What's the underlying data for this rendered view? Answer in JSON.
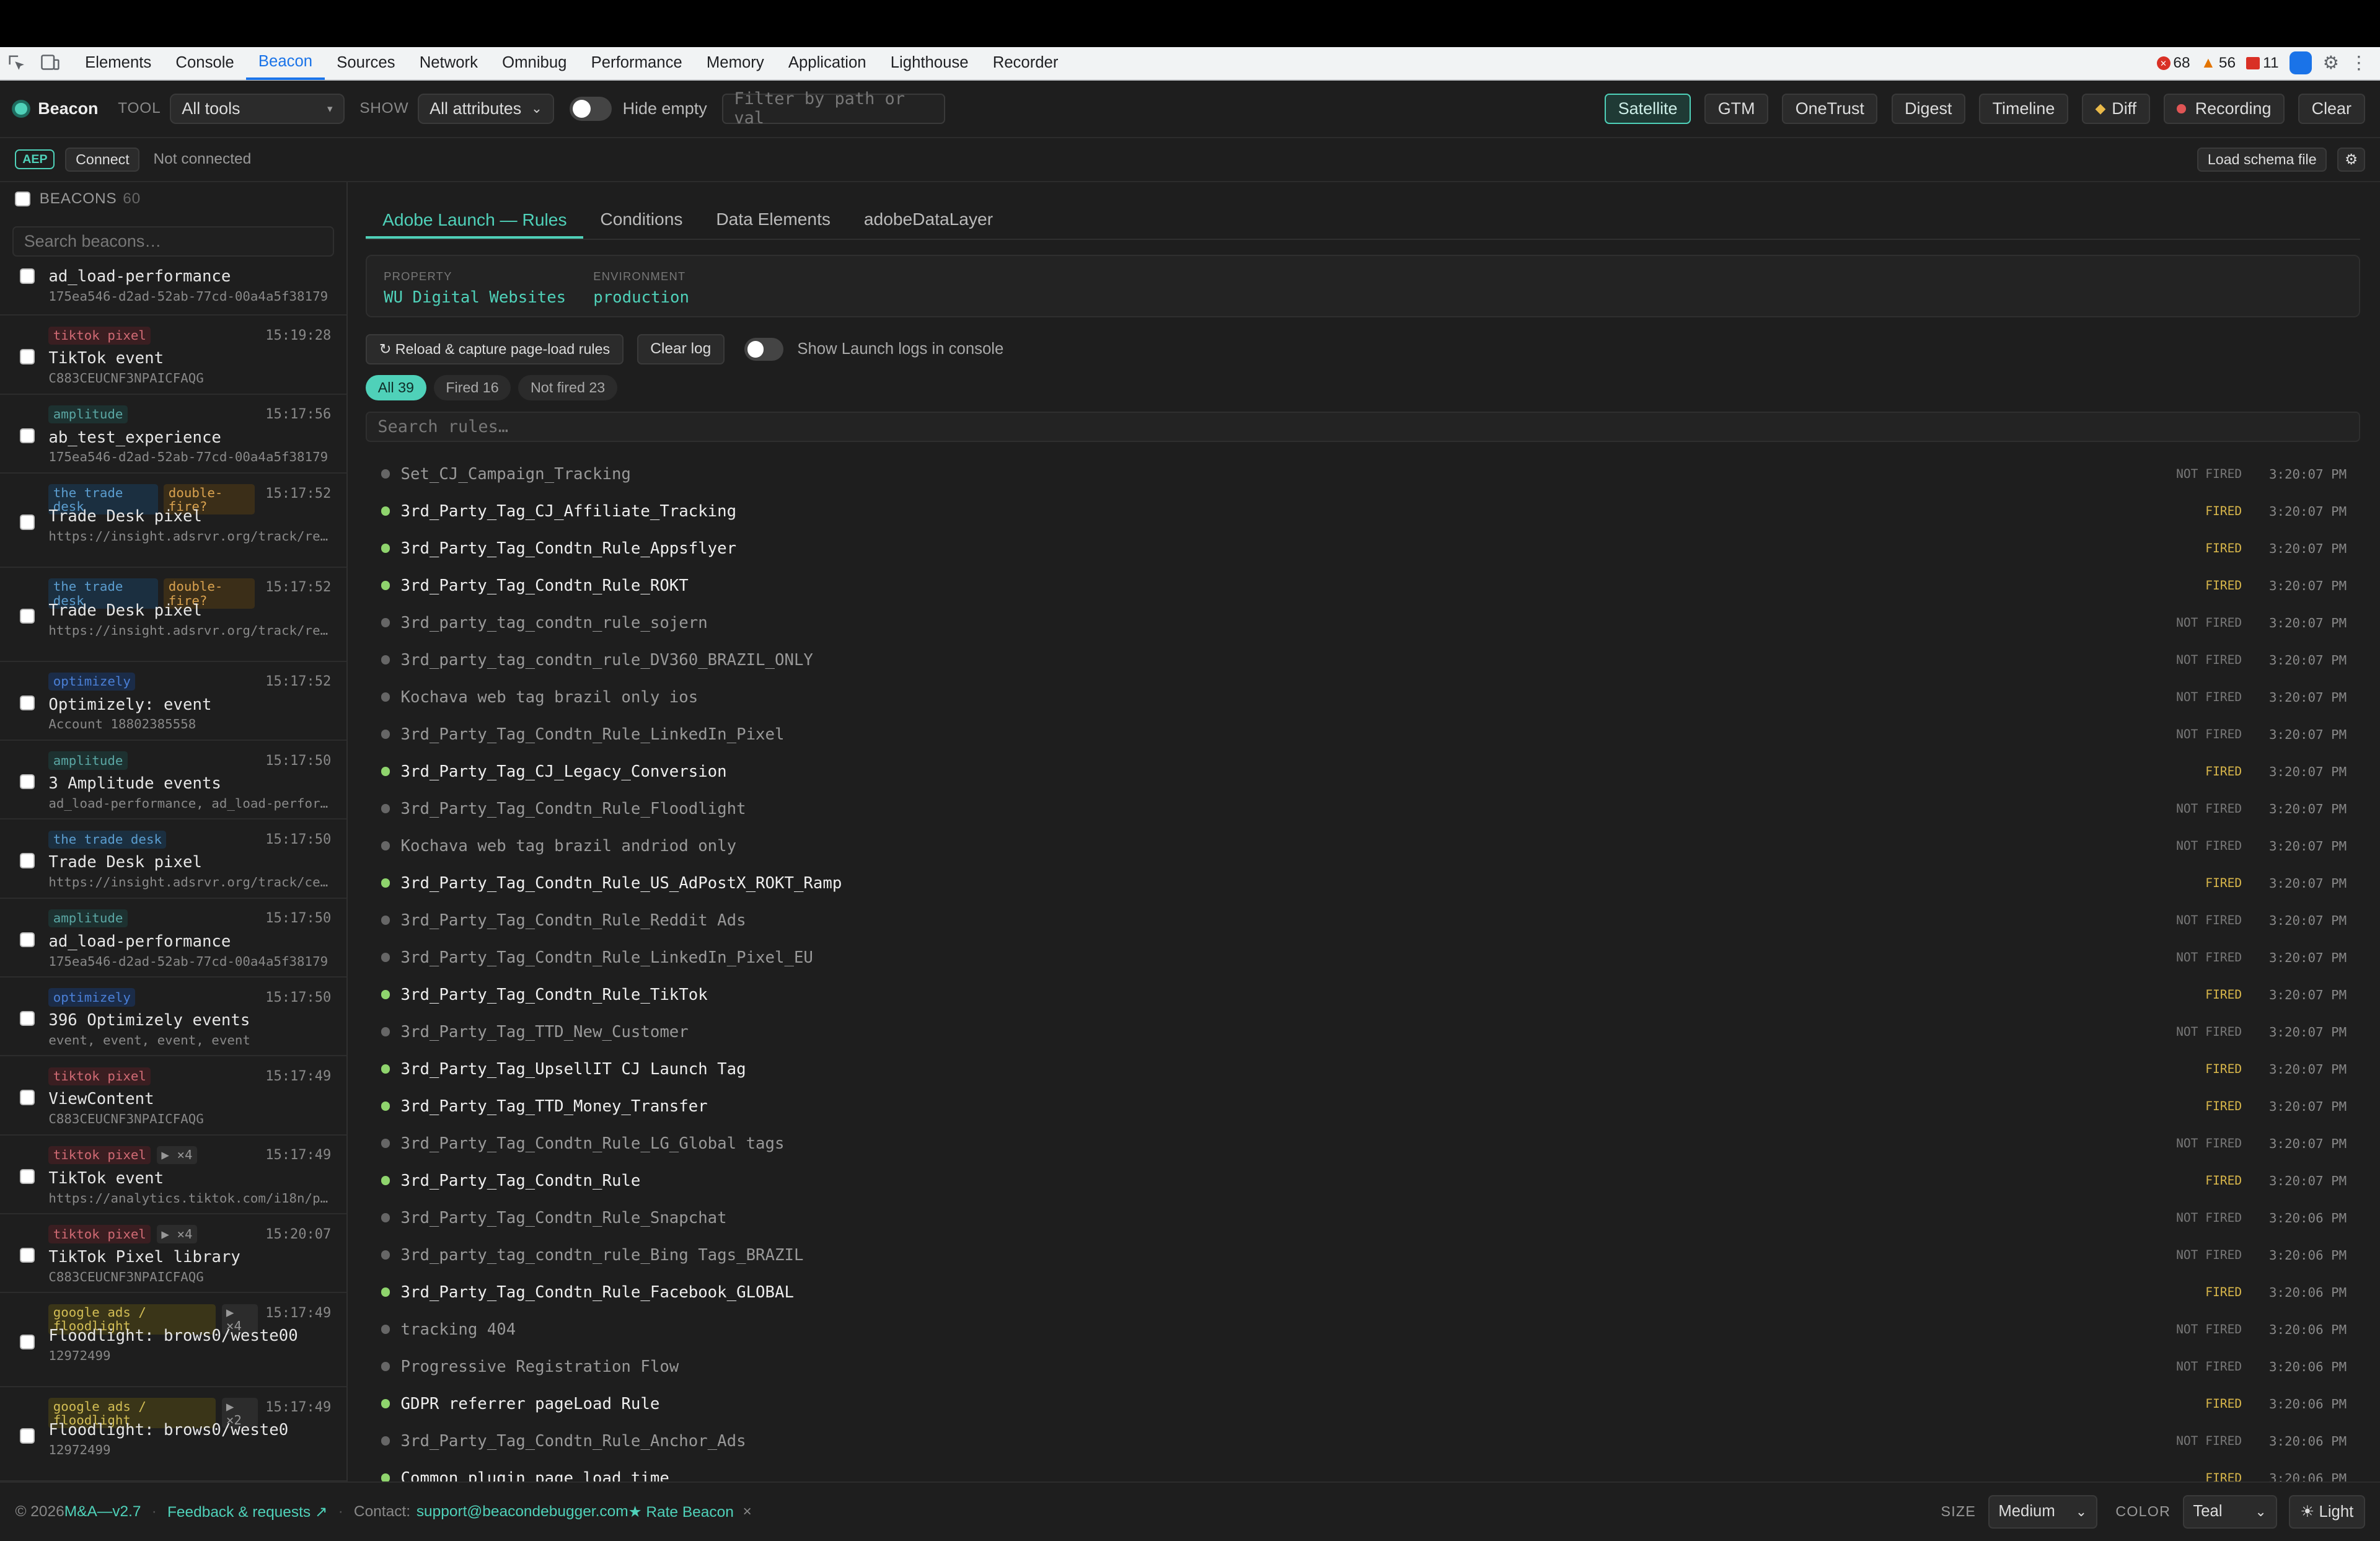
{
  "devtools": {
    "tabs": [
      "Elements",
      "Console",
      "Beacon",
      "Sources",
      "Network",
      "Omnibug",
      "Performance",
      "Memory",
      "Application",
      "Lighthouse",
      "Recorder"
    ],
    "active_tab": "Beacon",
    "errors": "68",
    "warnings": "56",
    "issues": "11"
  },
  "toolbar": {
    "brand": "Beacon",
    "tool_label": "TOOL",
    "tool_value": "All tools",
    "show_label": "SHOW",
    "show_value": "All attributes",
    "hide_empty": "Hide empty",
    "filter_placeholder": "Filter by path or val",
    "buttons": [
      "Satellite",
      "GTM",
      "OneTrust",
      "Digest",
      "Timeline",
      "Diff",
      "Recording",
      "Clear"
    ],
    "active_button": "Satellite"
  },
  "conn": {
    "badge": "AEP",
    "connect": "Connect",
    "status": "Not connected",
    "load_schema": "Load schema file",
    "settings_glyph": "⚙"
  },
  "sidebar": {
    "title": "BEACONS",
    "count": "60",
    "search_placeholder": "Search beacons…",
    "items": [
      {
        "tags": [],
        "time": "",
        "name": "ad_load-performance",
        "sub": "175ea546-d2ad-52ab-77cd-00a4a5f38179"
      },
      {
        "tags": [
          {
            "text": "tiktok pixel",
            "kind": "tiktok"
          }
        ],
        "time": "15:19:28",
        "name": "TikTok event",
        "sub": "C883CEUCNF3NPAICFAQG"
      },
      {
        "tags": [
          {
            "text": "amplitude",
            "kind": "amplitude"
          }
        ],
        "time": "15:17:56",
        "name": "ab_test_experience",
        "sub": "175ea546-d2ad-52ab-77cd-00a4a5f38179"
      },
      {
        "tags": [
          {
            "text": "the trade desk",
            "kind": "trade tall"
          },
          {
            "text": "double-fire?",
            "kind": "dbl tall2"
          }
        ],
        "time": "15:17:52",
        "name": "Trade Desk pixel",
        "sub": "https://insight.adsrvr.org/track/realtimeconversion"
      },
      {
        "tags": [
          {
            "text": "the trade desk",
            "kind": "trade tall"
          },
          {
            "text": "double-fire?",
            "kind": "dbl tall2"
          }
        ],
        "time": "15:17:52",
        "name": "Trade Desk pixel",
        "sub": "https://insight.adsrvr.org/track/realtimeconversion"
      },
      {
        "tags": [
          {
            "text": "optimizely",
            "kind": "opt"
          }
        ],
        "time": "15:17:52",
        "name": "Optimizely: event",
        "sub": "Account 18802385558"
      },
      {
        "tags": [
          {
            "text": "amplitude",
            "kind": "amplitude"
          }
        ],
        "time": "15:17:50",
        "name": "3 Amplitude events",
        "sub": "ad_load-performance, ad_load-performance, ad_load-performance"
      },
      {
        "tags": [
          {
            "text": "the trade desk",
            "kind": "trade"
          }
        ],
        "time": "15:17:50",
        "name": "Trade Desk pixel",
        "sub": "https://insight.adsrvr.org/track/cei?advertiser_id"
      },
      {
        "tags": [
          {
            "text": "amplitude",
            "kind": "amplitude"
          }
        ],
        "time": "15:17:50",
        "name": "ad_load-performance",
        "sub": "175ea546-d2ad-52ab-77cd-00a4a5f38179"
      },
      {
        "tags": [
          {
            "text": "optimizely",
            "kind": "opt"
          }
        ],
        "time": "15:17:50",
        "name": "396 Optimizely events",
        "sub": "event, event, event, event"
      },
      {
        "tags": [
          {
            "text": "tiktok pixel",
            "kind": "tiktok"
          }
        ],
        "time": "15:17:49",
        "name": "ViewContent",
        "sub": "C883CEUCNF3NPAICFAQG"
      },
      {
        "tags": [
          {
            "text": "tiktok pixel",
            "kind": "tiktok"
          },
          {
            "text": "▶ ×4",
            "kind": "count"
          }
        ],
        "time": "15:17:49",
        "name": "TikTok event",
        "sub": "https://analytics.tiktok.com/i18n/pixel/static/identify"
      },
      {
        "tags": [
          {
            "text": "tiktok pixel",
            "kind": "tiktok"
          },
          {
            "text": "▶ ×4",
            "kind": "count"
          }
        ],
        "time": "15:20:07",
        "name": "TikTok Pixel library",
        "sub": "C883CEUCNF3NPAICFAQG"
      },
      {
        "tags": [
          {
            "text": "google ads / floodlight",
            "kind": "gads tall3"
          },
          {
            "text": "▶ ×4",
            "kind": "count tiny"
          }
        ],
        "time": "15:17:49",
        "name": "Floodlight: brows0/weste00",
        "sub": "12972499"
      },
      {
        "tags": [
          {
            "text": "google ads / floodlight",
            "kind": "gads tall3"
          },
          {
            "text": "▶ ×2",
            "kind": "count tiny"
          }
        ],
        "time": "15:17:49",
        "name": "Floodlight: brows0/weste0",
        "sub": "12972499"
      }
    ]
  },
  "content": {
    "tabs": [
      "Adobe Launch — Rules",
      "Conditions",
      "Data Elements",
      "adobeDataLayer"
    ],
    "active_tab": "Adobe Launch — Rules",
    "property_label": "PROPERTY",
    "property_value": "WU Digital Websites",
    "env_label": "ENVIRONMENT",
    "env_value": "production",
    "reload_button": "↻ Reload & capture page-load rules",
    "clear_log": "Clear log",
    "show_logs": "Show Launch logs in console",
    "pills": [
      "All 39",
      "Fired 16",
      "Not fired 23"
    ],
    "rule_search": "Search rules…",
    "rules": [
      {
        "name": "Set_CJ_Campaign_Tracking",
        "status": "NOT FIRED",
        "time": "3:20:07 PM"
      },
      {
        "name": "3rd_Party_Tag_CJ_Affiliate_Tracking",
        "status": "FIRED",
        "time": "3:20:07 PM"
      },
      {
        "name": "3rd_Party_Tag_Condtn_Rule_Appsflyer",
        "status": "FIRED",
        "time": "3:20:07 PM"
      },
      {
        "name": "3rd_Party_Tag_Condtn_Rule_ROKT",
        "status": "FIRED",
        "time": "3:20:07 PM"
      },
      {
        "name": "3rd_party_tag_condtn_rule_sojern",
        "status": "NOT FIRED",
        "time": "3:20:07 PM"
      },
      {
        "name": "3rd_party_tag_condtn_rule_DV360_BRAZIL_ONLY",
        "status": "NOT FIRED",
        "time": "3:20:07 PM"
      },
      {
        "name": "Kochava web tag brazil only ios",
        "status": "NOT FIRED",
        "time": "3:20:07 PM"
      },
      {
        "name": "3rd_Party_Tag_Condtn_Rule_LinkedIn_Pixel",
        "status": "NOT FIRED",
        "time": "3:20:07 PM"
      },
      {
        "name": "3rd_Party_Tag_CJ_Legacy_Conversion",
        "status": "FIRED",
        "time": "3:20:07 PM"
      },
      {
        "name": "3rd_Party_Tag_Condtn_Rule_Floodlight",
        "status": "NOT FIRED",
        "time": "3:20:07 PM"
      },
      {
        "name": "Kochava web tag brazil andriod only",
        "status": "NOT FIRED",
        "time": "3:20:07 PM"
      },
      {
        "name": "3rd_Party_Tag_Condtn_Rule_US_AdPostX_ROKT_Ramp",
        "status": "FIRED",
        "time": "3:20:07 PM"
      },
      {
        "name": "3rd_Party_Tag_Condtn_Rule_Reddit Ads",
        "status": "NOT FIRED",
        "time": "3:20:07 PM"
      },
      {
        "name": "3rd_Party_Tag_Condtn_Rule_LinkedIn_Pixel_EU",
        "status": "NOT FIRED",
        "time": "3:20:07 PM"
      },
      {
        "name": "3rd_Party_Tag_Condtn_Rule_TikTok",
        "status": "FIRED",
        "time": "3:20:07 PM"
      },
      {
        "name": "3rd_Party_Tag_TTD_New_Customer",
        "status": "NOT FIRED",
        "time": "3:20:07 PM"
      },
      {
        "name": "3rd_Party_Tag_UpsellIT CJ Launch Tag",
        "status": "FIRED",
        "time": "3:20:07 PM"
      },
      {
        "name": "3rd_Party_Tag_TTD_Money_Transfer",
        "status": "FIRED",
        "time": "3:20:07 PM"
      },
      {
        "name": "3rd_Party_Tag_Condtn_Rule_LG_Global tags",
        "status": "NOT FIRED",
        "time": "3:20:07 PM"
      },
      {
        "name": "3rd_Party_Tag_Condtn_Rule",
        "status": "FIRED",
        "time": "3:20:07 PM"
      },
      {
        "name": "3rd_Party_Tag_Condtn_Rule_Snapchat",
        "status": "NOT FIRED",
        "time": "3:20:06 PM"
      },
      {
        "name": "3rd_party_tag_condtn_rule_Bing Tags_BRAZIL",
        "status": "NOT FIRED",
        "time": "3:20:06 PM"
      },
      {
        "name": "3rd_Party_Tag_Condtn_Rule_Facebook_GLOBAL",
        "status": "FIRED",
        "time": "3:20:06 PM"
      },
      {
        "name": "tracking 404",
        "status": "NOT FIRED",
        "time": "3:20:06 PM"
      },
      {
        "name": "Progressive Registration Flow",
        "status": "NOT FIRED",
        "time": "3:20:06 PM"
      },
      {
        "name": "GDPR referrer pageLoad Rule",
        "status": "FIRED",
        "time": "3:20:06 PM"
      },
      {
        "name": "3rd_Party_Tag_Condtn_Rule_Anchor_Ads",
        "status": "NOT FIRED",
        "time": "3:20:06 PM"
      },
      {
        "name": "Common plugin page load time",
        "status": "FIRED",
        "time": "3:20:06 PM"
      }
    ]
  },
  "footer": {
    "copyright": "© 2026",
    "version": "M&A—v2.7",
    "feedback": "Feedback & requests ↗",
    "contact_label": "Contact:",
    "contact_email": "support@beacondebugger.com",
    "rate": "★ Rate Beacon",
    "close_glyph": "×",
    "size_label": "SIZE",
    "size_value": "Medium",
    "color_label": "COLOR",
    "color_value": "Teal",
    "theme": "☀ Light"
  }
}
